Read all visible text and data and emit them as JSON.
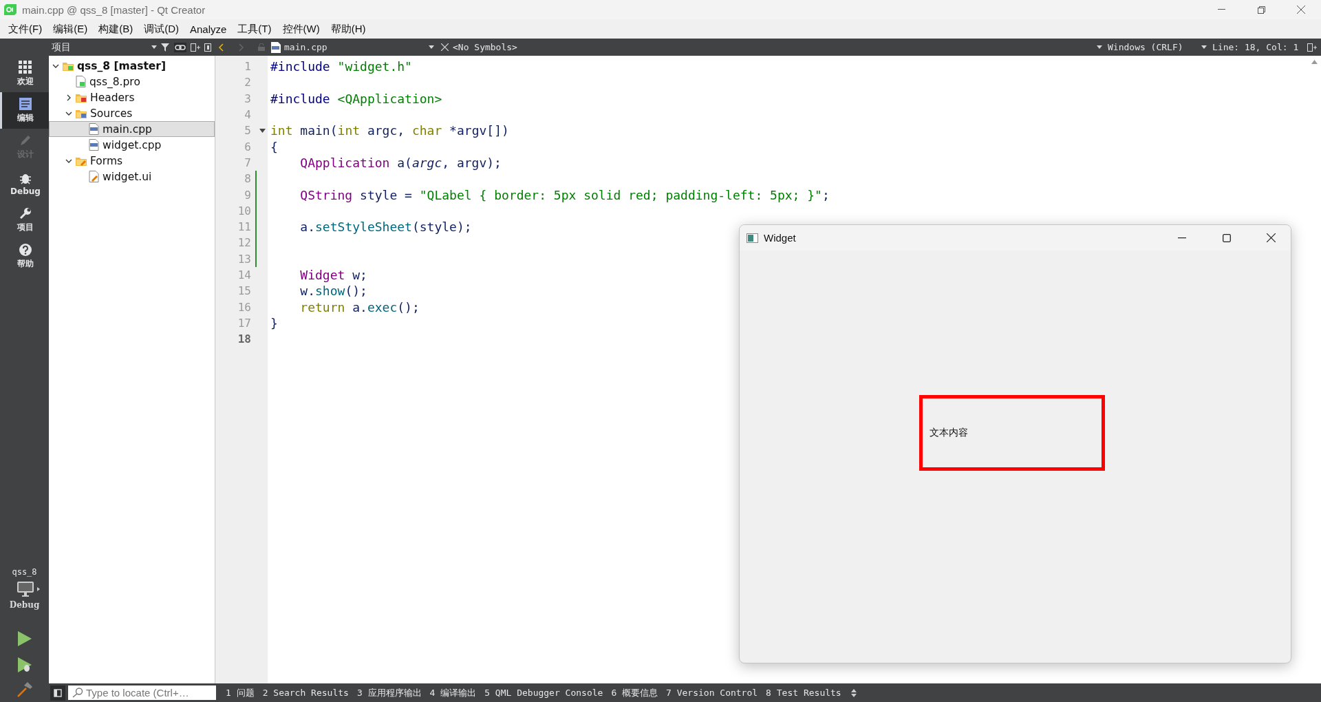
{
  "window": {
    "title": "main.cpp @ qss_8 [master] - Qt Creator"
  },
  "menu": [
    "文件(F)",
    "编辑(E)",
    "构建(B)",
    "调试(D)",
    "Analyze",
    "工具(T)",
    "控件(W)",
    "帮助(H)"
  ],
  "modes": [
    {
      "label": "欢迎",
      "kind": "grid",
      "selected": false,
      "disabled": false
    },
    {
      "label": "编辑",
      "kind": "doc",
      "selected": true,
      "disabled": false
    },
    {
      "label": "设计",
      "kind": "pen",
      "selected": false,
      "disabled": true
    },
    {
      "label": "Debug",
      "kind": "bug",
      "selected": false,
      "disabled": false
    },
    {
      "label": "项目",
      "kind": "wrench",
      "selected": false,
      "disabled": false
    },
    {
      "label": "帮助",
      "kind": "help",
      "selected": false,
      "disabled": false
    }
  ],
  "target": {
    "project": "qss_8",
    "build": "Debug"
  },
  "navigator": {
    "title": "项目",
    "tree": [
      {
        "label": "qss_8 [master]",
        "kind": "project",
        "expanded": true,
        "selected": false,
        "children": [
          {
            "label": "qss_8.pro",
            "kind": "pro",
            "selected": false
          },
          {
            "label": "Headers",
            "kind": "headers",
            "expanded": false,
            "selected": false
          },
          {
            "label": "Sources",
            "kind": "sources",
            "expanded": true,
            "selected": false,
            "children": [
              {
                "label": "main.cpp",
                "kind": "cpp",
                "selected": true
              },
              {
                "label": "widget.cpp",
                "kind": "cpp",
                "selected": false
              }
            ]
          },
          {
            "label": "Forms",
            "kind": "forms",
            "expanded": true,
            "selected": false,
            "children": [
              {
                "label": "widget.ui",
                "kind": "ui",
                "selected": false
              }
            ]
          }
        ]
      }
    ]
  },
  "editor": {
    "file": "main.cpp",
    "symbols": "<No Symbols>",
    "line_ending": "Windows (CRLF)",
    "position": "Line: 18, Col: 1",
    "lines": [
      {
        "number": "1",
        "modified": false,
        "current": false,
        "tokens": [
          {
            "kind": "preproc",
            "text": "#include"
          },
          {
            "kind": "string",
            "text": " \"widget.h\""
          }
        ]
      },
      {
        "number": "2",
        "modified": false,
        "current": false
      },
      {
        "number": "3",
        "modified": false,
        "current": false,
        "tokens": [
          {
            "kind": "preproc",
            "text": "#include"
          },
          {
            "kind": "string",
            "text": " <QApplication>"
          }
        ]
      },
      {
        "number": "4",
        "modified": false,
        "current": false
      },
      {
        "number": "5",
        "modified": false,
        "foldable": true,
        "current": false,
        "tokens": [
          {
            "kind": "type",
            "text": "int"
          },
          {
            "kind": "plain",
            "text": " main("
          },
          {
            "kind": "type",
            "text": "int"
          },
          {
            "kind": "plain",
            "text": " argc, "
          },
          {
            "kind": "type",
            "text": "char"
          },
          {
            "kind": "plain",
            "text": " *argv[])"
          }
        ]
      },
      {
        "number": "6",
        "modified": false,
        "current": false,
        "tokens": [
          {
            "kind": "plain",
            "text": "{"
          }
        ]
      },
      {
        "number": "7",
        "modified": false,
        "current": false,
        "tokens": [
          {
            "kind": "class",
            "text": "    QApplication"
          },
          {
            "kind": "plain",
            "text": " a("
          },
          {
            "kind": "param",
            "text": "argc"
          },
          {
            "kind": "plain",
            "text": ", argv);"
          }
        ]
      },
      {
        "number": "8",
        "modified": true,
        "current": false
      },
      {
        "number": "9",
        "modified": true,
        "current": false,
        "tokens": [
          {
            "kind": "class",
            "text": "    QString"
          },
          {
            "kind": "plain",
            "text": " style = "
          },
          {
            "kind": "string",
            "text": "\"QLabel { border: 5px solid red; padding-left: 5px; }\""
          },
          {
            "kind": "plain",
            "text": ";"
          }
        ]
      },
      {
        "number": "10",
        "modified": true,
        "current": false
      },
      {
        "number": "11",
        "modified": true,
        "current": false,
        "tokens": [
          {
            "kind": "plain",
            "text": "    a."
          },
          {
            "kind": "func",
            "text": "setStyleSheet"
          },
          {
            "kind": "plain",
            "text": "(style);"
          }
        ]
      },
      {
        "number": "12",
        "modified": true,
        "current": false
      },
      {
        "number": "13",
        "modified": true,
        "current": false
      },
      {
        "number": "14",
        "modified": false,
        "current": false,
        "tokens": [
          {
            "kind": "class",
            "text": "    Widget"
          },
          {
            "kind": "plain",
            "text": " w;"
          }
        ]
      },
      {
        "number": "15",
        "modified": false,
        "current": false,
        "tokens": [
          {
            "kind": "plain",
            "text": "    w."
          },
          {
            "kind": "func",
            "text": "show"
          },
          {
            "kind": "plain",
            "text": "();"
          }
        ]
      },
      {
        "number": "16",
        "modified": false,
        "current": false,
        "tokens": [
          {
            "kind": "type",
            "text": "    return"
          },
          {
            "kind": "plain",
            "text": " a."
          },
          {
            "kind": "func",
            "text": "exec"
          },
          {
            "kind": "plain",
            "text": "();"
          }
        ]
      },
      {
        "number": "17",
        "modified": false,
        "current": false,
        "tokens": [
          {
            "kind": "plain",
            "text": "}"
          }
        ]
      },
      {
        "number": "18",
        "modified": false,
        "current": true
      }
    ]
  },
  "locator": {
    "placeholder": "Type to locate (Ctrl+…"
  },
  "output_tabs": [
    "1 问题",
    "2 Search Results",
    "3 应用程序输出",
    "4 编译输出",
    "5 QML Debugger Console",
    "6 概要信息",
    "7 Version Control",
    "8 Test Results"
  ],
  "app_window": {
    "title": "Widget",
    "label": "文本内容"
  }
}
